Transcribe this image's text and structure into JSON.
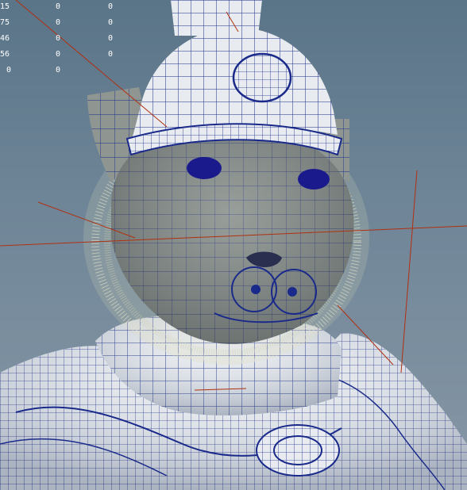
{
  "viewport": {
    "background_top": "#5a7488",
    "background_bottom": "#8797a6",
    "wireframe_color": "#1a2a8a",
    "surface_color": "#e8ecf0",
    "head_color": "#8a9090",
    "fur_color": "#e6e6c8",
    "eye_color": "#1a1a8c",
    "guide_line_color": "#b03010"
  },
  "stats_hud": {
    "rows": [
      [
        "15",
        "0",
        "0"
      ],
      [
        "75",
        "0",
        "0"
      ],
      [
        "46",
        "0",
        "0"
      ],
      [
        "56",
        "0",
        "0"
      ],
      [
        "0",
        "0",
        ""
      ]
    ]
  },
  "icons": [
    "cat-warrior-model-icon"
  ]
}
